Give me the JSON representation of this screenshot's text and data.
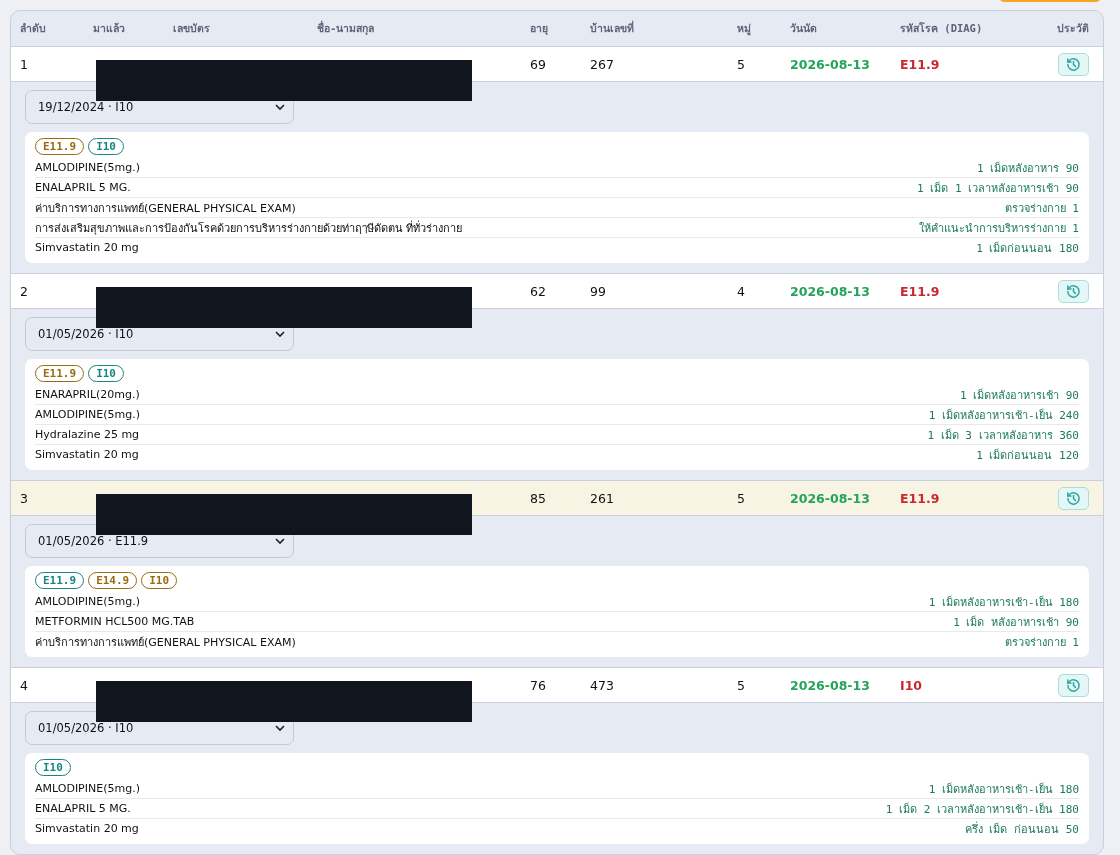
{
  "table": {
    "columns": [
      "ลำดับ",
      "มาแล้ว",
      "เลขบัตร",
      "ชื่อ-นามสกุล",
      "อายุ",
      "บ้านเลขที่",
      "หมู่",
      "วันนัด",
      "รหัสโรค (DIAG)",
      "ประวัติ"
    ],
    "rows": [
      {
        "no": "1",
        "age": "69",
        "house": "267",
        "moo": "5",
        "appointment": "2026-08-13",
        "diag": "E11.9",
        "selected": false,
        "visit": "19/12/2024 · I10",
        "tags": [
          {
            "label": "E11.9",
            "color": "#9a6a12"
          },
          {
            "label": "I10",
            "color": "#1a8580"
          }
        ],
        "items": [
          {
            "name": "AMLODIPINE(5mg.)",
            "dose": "1 เม็ดหลังอาหาร 90"
          },
          {
            "name": "ENALAPRIL 5 MG.",
            "dose": "1 เม็ด 1 เวลาหลังอาหารเช้า 90"
          },
          {
            "name": "ค่าบริการทางการแพทย์(GENERAL PHYSICAL EXAM)",
            "dose": "ตรวจร่างกาย 1"
          },
          {
            "name": "การส่งเสริมสุขภาพและการป้องกันโรคด้วยการบริหารร่างกายด้วยท่าฤๅษีดัดตน ที่ทั่วร่างกาย",
            "dose": "ให้คำแนะนำการบริหารร่างกาย 1"
          },
          {
            "name": "Simvastatin 20 mg",
            "dose": "1 เม็ดก่อนนอน 180"
          }
        ]
      },
      {
        "no": "2",
        "age": "62",
        "house": "99",
        "moo": "4",
        "appointment": "2026-08-13",
        "diag": "E11.9",
        "selected": false,
        "visit": "01/05/2026 · I10",
        "tags": [
          {
            "label": "E11.9",
            "color": "#9a6a12"
          },
          {
            "label": "I10",
            "color": "#1a8580"
          }
        ],
        "items": [
          {
            "name": "ENARAPRIL(20mg.)",
            "dose": "1 เม็ดหลังอาหารเช้า 90"
          },
          {
            "name": "AMLODIPINE(5mg.)",
            "dose": "1 เม็ดหลังอาหารเช้า-เย็น 240"
          },
          {
            "name": "Hydralazine 25 mg",
            "dose": "1 เม็ด 3 เวลาหลังอาหาร 360"
          },
          {
            "name": "Simvastatin 20 mg",
            "dose": "1 เม็ดก่อนนอน 120"
          }
        ]
      },
      {
        "no": "3",
        "age": "85",
        "house": "261",
        "moo": "5",
        "appointment": "2026-08-13",
        "diag": "E11.9",
        "selected": true,
        "visit": "01/05/2026 · E11.9",
        "tags": [
          {
            "label": "E11.9",
            "color": "#1a8580"
          },
          {
            "label": "E14.9",
            "color": "#9a6a12"
          },
          {
            "label": "I10",
            "color": "#9a6a12"
          }
        ],
        "items": [
          {
            "name": "AMLODIPINE(5mg.)",
            "dose": "1 เม็ดหลังอาหารเช้า-เย็น 180"
          },
          {
            "name": "METFORMIN HCL500 MG.TAB",
            "dose": "1 เม็ด หลังอาหารเช้า 90"
          },
          {
            "name": "ค่าบริการทางการแพทย์(GENERAL PHYSICAL EXAM)",
            "dose": "ตรวจร่างกาย 1"
          }
        ]
      },
      {
        "no": "4",
        "age": "76",
        "house": "473",
        "moo": "5",
        "appointment": "2026-08-13",
        "diag": "I10",
        "selected": false,
        "visit": "01/05/2026 · I10",
        "tags": [
          {
            "label": "I10",
            "color": "#1a8580"
          }
        ],
        "items": [
          {
            "name": "AMLODIPINE(5mg.)",
            "dose": "1 เม็ดหลังอาหารเช้า-เย็น 180"
          },
          {
            "name": "ENALAPRIL 5 MG.",
            "dose": "1 เม็ด 2 เวลาหลังอาหารเช้า-เย็น 180"
          },
          {
            "name": "Simvastatin 20 mg",
            "dose": "ครึ่ง เม็ด ก่อนนอน 50"
          }
        ]
      }
    ]
  }
}
